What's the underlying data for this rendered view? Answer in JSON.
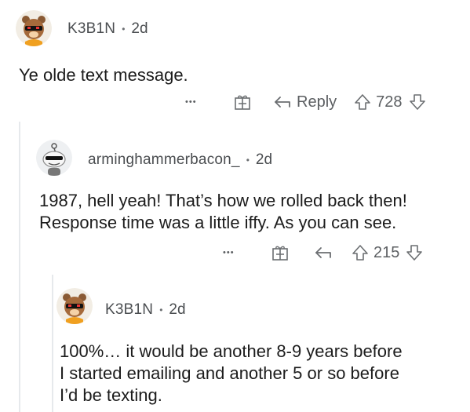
{
  "comments": [
    {
      "username": "K3B1N",
      "age": "2d",
      "text": "Ye olde text message.",
      "reply_label": "Reply",
      "more_label": "•••",
      "votes": "728"
    },
    {
      "username": "arminghammerbacon_",
      "age": "2d",
      "text_lines": [
        "1987, hell yeah! That’s how we rolled back then!",
        "Response time was a little iffy. As you can see."
      ],
      "more_label": "•••",
      "votes": "215"
    },
    {
      "username": "K3B1N",
      "age": "2d",
      "text_lines": [
        "100%… it would be another 8-9 years before",
        "I started emailing and another 5 or so before",
        "I’d be texting."
      ]
    }
  ],
  "separator": "•",
  "icons": {
    "more": "more-options-icon",
    "award": "award-gift-icon",
    "reply": "reply-arrow-icon",
    "upvote": "upvote-arrow-icon",
    "downvote": "downvote-arrow-icon"
  },
  "colors": {
    "thread_line": "#e6e9ec",
    "meta_text": "#4a4d50",
    "action_gray": "#6b6e71",
    "avatar_bg": "#f2ede4"
  }
}
